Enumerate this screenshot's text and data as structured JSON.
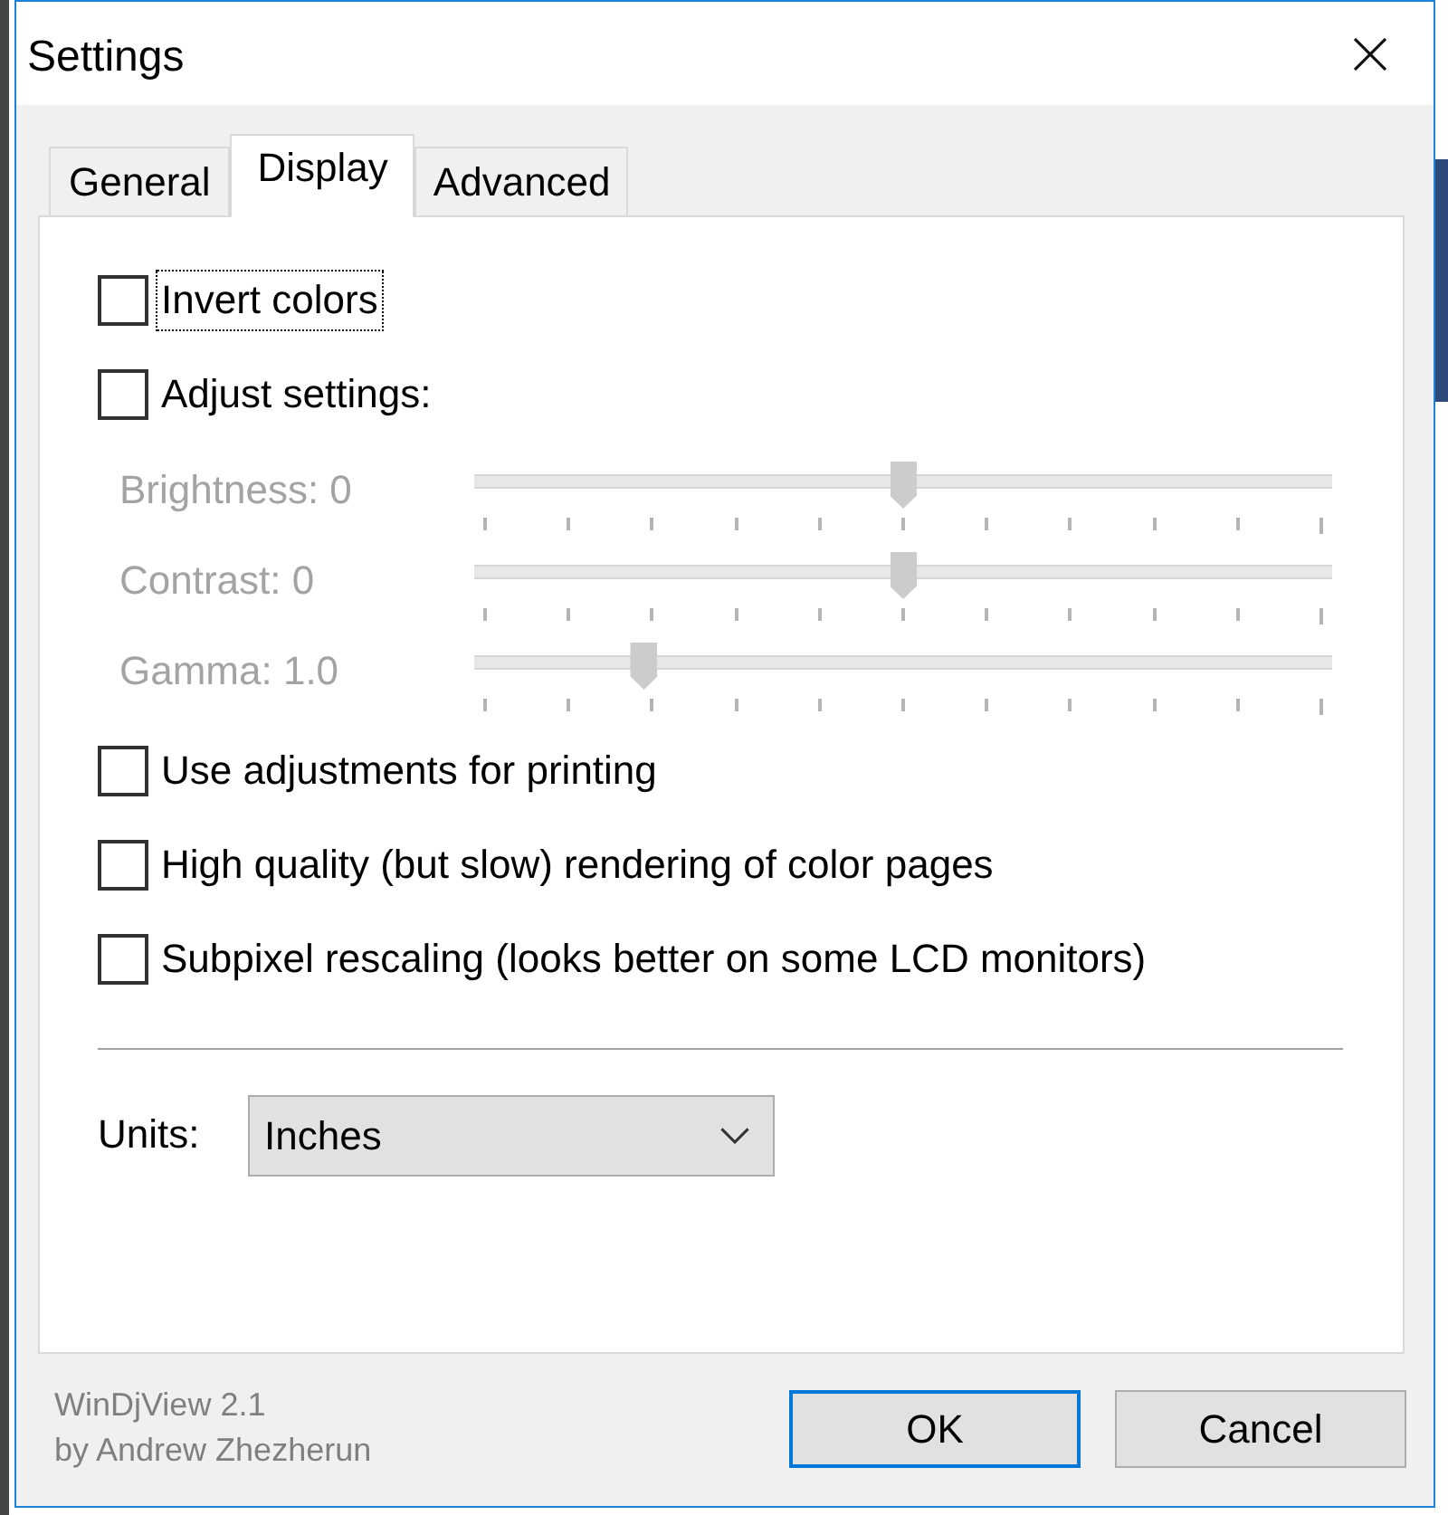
{
  "window": {
    "title": "Settings"
  },
  "tabs": [
    {
      "label": "General",
      "selected": false
    },
    {
      "label": "Display",
      "selected": true
    },
    {
      "label": "Advanced",
      "selected": false
    }
  ],
  "display_options": [
    {
      "label": "Invert colors",
      "checked": false,
      "focused": true
    },
    {
      "label": "Adjust settings:",
      "checked": false,
      "focused": false
    }
  ],
  "adjustments": [
    {
      "label": "Brightness: 0",
      "level": 0.5,
      "disabled": true
    },
    {
      "label": "Contrast: 0",
      "level": 0.5,
      "disabled": true
    },
    {
      "label": "Gamma: 1.0",
      "level": 0.19,
      "disabled": true
    }
  ],
  "more_options": [
    {
      "label": "Use adjustments for printing",
      "checked": false,
      "focused": false
    },
    {
      "label": "High quality (but slow) rendering of color pages",
      "checked": false,
      "focused": false
    },
    {
      "label": "Subpixel rescaling (looks better on some LCD monitors)",
      "checked": false,
      "focused": false
    }
  ],
  "units": {
    "label": "Units:",
    "value": "Inches"
  },
  "about": [
    "WinDjView 2.1",
    "by Andrew Zhezherun"
  ],
  "buttons": [
    {
      "label": "OK",
      "default": true
    },
    {
      "label": "Cancel",
      "default": false
    }
  ]
}
